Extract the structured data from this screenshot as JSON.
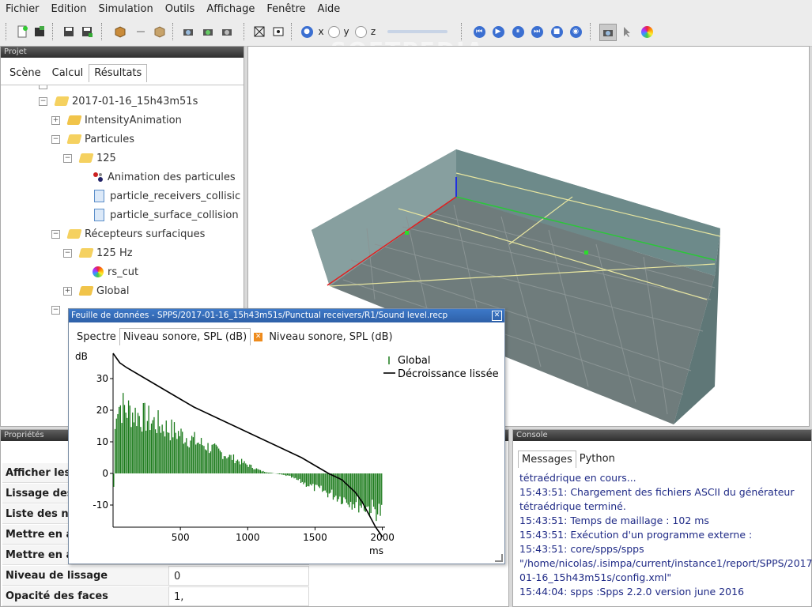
{
  "menu": [
    "Fichier",
    "Edition",
    "Simulation",
    "Outils",
    "Affichage",
    "Fenêtre",
    "Aide"
  ],
  "toolbar": {
    "axis_x": "x",
    "axis_y": "y",
    "axis_z": "z"
  },
  "watermark": "SOFTPEDIA",
  "project_panel": {
    "title": "Projet",
    "tabs": [
      "Scène",
      "Calcul",
      "Résultats"
    ],
    "active_tab": "Résultats",
    "tree": [
      {
        "label": "2017-01-16_15h43m51s",
        "exp": "−",
        "icon": "folder-open"
      },
      {
        "label": "IntensityAnimation",
        "exp": "+",
        "icon": "folder"
      },
      {
        "label": "Particules",
        "exp": "−",
        "icon": "folder-open"
      },
      {
        "label": "125",
        "exp": "−",
        "icon": "folder-open"
      },
      {
        "label": "Animation des particules",
        "exp": "",
        "icon": "animation"
      },
      {
        "label": "particle_receivers_collisic",
        "exp": "",
        "icon": "file"
      },
      {
        "label": "particle_surface_collision",
        "exp": "",
        "icon": "file"
      },
      {
        "label": "Récepteurs surfaciques",
        "exp": "−",
        "icon": "folder-open"
      },
      {
        "label": "125 Hz",
        "exp": "−",
        "icon": "folder-open"
      },
      {
        "label": "rs_cut",
        "exp": "",
        "icon": "colormap"
      },
      {
        "label": "Global",
        "exp": "+",
        "icon": "folder"
      }
    ]
  },
  "properties_panel": {
    "title": "Propriétés",
    "rows": [
      {
        "key": "Afficher les",
        "value": ""
      },
      {
        "key": "Lissage des",
        "value": ""
      },
      {
        "key": "Liste des ni",
        "value": ""
      },
      {
        "key": "Mettre en a",
        "value": ""
      },
      {
        "key": "Mettre en a",
        "value": ""
      },
      {
        "key": "Niveau de lissage",
        "value": "0"
      },
      {
        "key": "Opacité des faces",
        "value": "1,"
      }
    ]
  },
  "console_panel": {
    "title": "Console",
    "tabs": [
      "Messages",
      "Python"
    ],
    "active_tab": "Messages",
    "lines": [
      "tétraédrique en cours...",
      "15:43:51: Chargement des fichiers ASCII du générateur tétraédrique terminé.",
      "15:43:51: Temps de maillage : 102 ms",
      "15:43:51: Exécution d'un programme externe :",
      "15:43:51: core/spps/spps \"/home/nicolas/.isimpa/current/instance1/report/SPPS/2017-01-16_15h43m51s/config.xml\"",
      "15:44:04: spps :Spps 2.2.0 version june 2016"
    ]
  },
  "data_sheet": {
    "title": "Feuille de données - SPPS/2017-01-16_15h43m51s/Punctual receivers/R1/Sound level.recp",
    "tabs": [
      "Spectre",
      "Niveau sonore, SPL (dB)",
      "Niveau sonore, SPL (dB)"
    ],
    "active_tab_index": 1
  },
  "chart_data": {
    "type": "bar",
    "ylabel": "dB",
    "xlabel": "ms",
    "xlim": [
      0,
      2020
    ],
    "ylim": [
      -17,
      38
    ],
    "xticks": [
      500,
      1000,
      1500,
      2000
    ],
    "yticks": [
      -10,
      0,
      10,
      20,
      30
    ],
    "legend_position": "top-right",
    "colors": {
      "global": "#1a7a1a",
      "smoothed": "#000000"
    },
    "series": [
      {
        "name": "Global",
        "type": "bar",
        "x_start": 5,
        "x_step": 10,
        "envelope_ms": [
          0,
          20,
          100,
          300,
          500,
          700,
          900,
          1100,
          1200,
          1300,
          1500,
          1700,
          1900,
          2000
        ],
        "envelope_db": [
          -17,
          29,
          26,
          21,
          16,
          11,
          6,
          1,
          0,
          -1,
          -6,
          -10,
          -14,
          -16
        ]
      },
      {
        "name": "Décroissance lissée",
        "type": "line",
        "x": [
          0,
          50,
          100,
          200,
          300,
          400,
          500,
          600,
          700,
          800,
          900,
          1000,
          1100,
          1200,
          1300,
          1400,
          1500,
          1600,
          1700,
          1800,
          1850,
          1900,
          1950,
          2000
        ],
        "y": [
          38,
          35,
          33.5,
          31,
          28.5,
          26,
          23.5,
          21,
          19,
          17,
          15,
          13,
          11,
          9,
          7,
          5,
          2.5,
          0,
          -2,
          -6,
          -9,
          -13,
          -17,
          -20
        ]
      }
    ]
  }
}
